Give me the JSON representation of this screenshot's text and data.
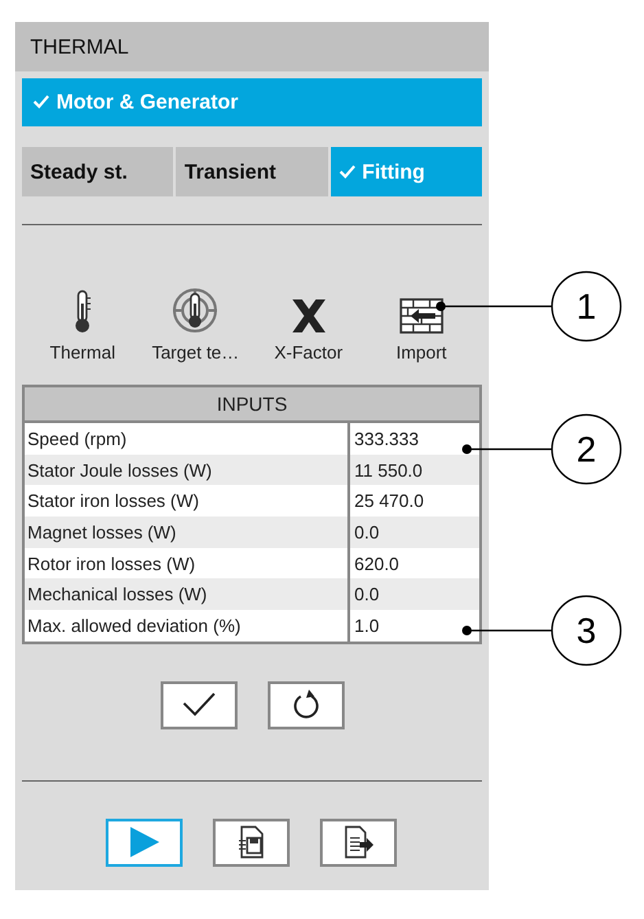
{
  "panel": {
    "title": "THERMAL"
  },
  "category": {
    "label": "Motor & Generator",
    "selected": true
  },
  "tabs": [
    {
      "label": "Steady st.",
      "selected": false
    },
    {
      "label": "Transient",
      "selected": false
    },
    {
      "label": "Fitting",
      "selected": true
    }
  ],
  "tools": [
    {
      "kind": "thermal",
      "label": "Thermal"
    },
    {
      "kind": "target",
      "label": "Target te…"
    },
    {
      "kind": "xfactor",
      "label": "X-Factor"
    },
    {
      "kind": "import",
      "label": "Import"
    }
  ],
  "inputs": {
    "title": "INPUTS",
    "rows": [
      {
        "name": "Speed (rpm)",
        "value": "333.333"
      },
      {
        "name": "Stator Joule losses (W)",
        "value": "11 550.0"
      },
      {
        "name": "Stator iron losses (W)",
        "value": "25 470.0"
      },
      {
        "name": "Magnet losses (W)",
        "value": "0.0"
      },
      {
        "name": "Rotor iron losses (W)",
        "value": "620.0"
      },
      {
        "name": "Mechanical losses (W)",
        "value": "0.0"
      },
      {
        "name": "Max. allowed deviation (%)",
        "value": "1.0"
      }
    ]
  },
  "actions": [
    {
      "kind": "apply"
    },
    {
      "kind": "reset"
    }
  ],
  "bottom_buttons": [
    {
      "kind": "run",
      "selected": true
    },
    {
      "kind": "save",
      "selected": false
    },
    {
      "kind": "export",
      "selected": false
    }
  ],
  "callouts": [
    {
      "number": "1"
    },
    {
      "number": "2"
    },
    {
      "number": "3"
    }
  ]
}
